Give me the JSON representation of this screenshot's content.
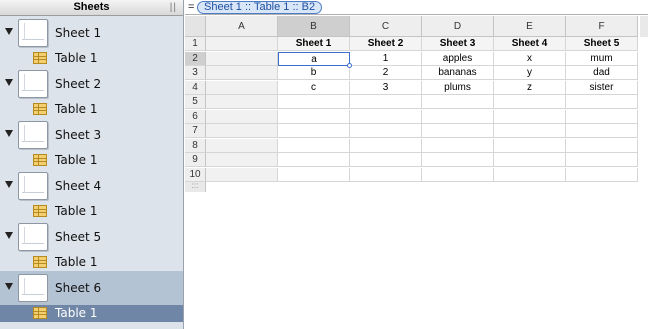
{
  "sidebar": {
    "title": "Sheets",
    "grip": "||",
    "sheets": [
      {
        "label": "Sheet 1",
        "table": "Table 1"
      },
      {
        "label": "Sheet 2",
        "table": "Table 1"
      },
      {
        "label": "Sheet 3",
        "table": "Table 1"
      },
      {
        "label": "Sheet 4",
        "table": "Table 1"
      },
      {
        "label": "Sheet 5",
        "table": "Table 1"
      },
      {
        "label": "Sheet 6",
        "table": "Table 1"
      }
    ],
    "selected_sheet_index": 5
  },
  "formula_bar": {
    "equals": "=",
    "reference": "Sheet 1 :: Table 1 :: B2"
  },
  "grid": {
    "columns": [
      "A",
      "B",
      "C",
      "D",
      "E",
      "F"
    ],
    "rows": [
      "1",
      "2",
      "3",
      "4",
      "5",
      "6",
      "7",
      "8",
      "9",
      "10"
    ],
    "active_column": "B",
    "active_row": "2",
    "header_row": [
      "",
      "Sheet 1",
      "Sheet 2",
      "Sheet 3",
      "Sheet 4",
      "Sheet 5"
    ],
    "data": [
      [
        "",
        "a",
        "1",
        "apples",
        "x",
        "mum"
      ],
      [
        "",
        "b",
        "2",
        "bananas",
        "y",
        "dad"
      ],
      [
        "",
        "c",
        "3",
        "plums",
        "z",
        "sister"
      ]
    ],
    "grip_glyph": ":::"
  },
  "colors": {
    "sidebar_bg": "#dde3ea",
    "selected_sheet_bg": "#b4c3d4",
    "selected_table_bg": "#6f86a6",
    "selection_blue": "#3a6fcf"
  }
}
